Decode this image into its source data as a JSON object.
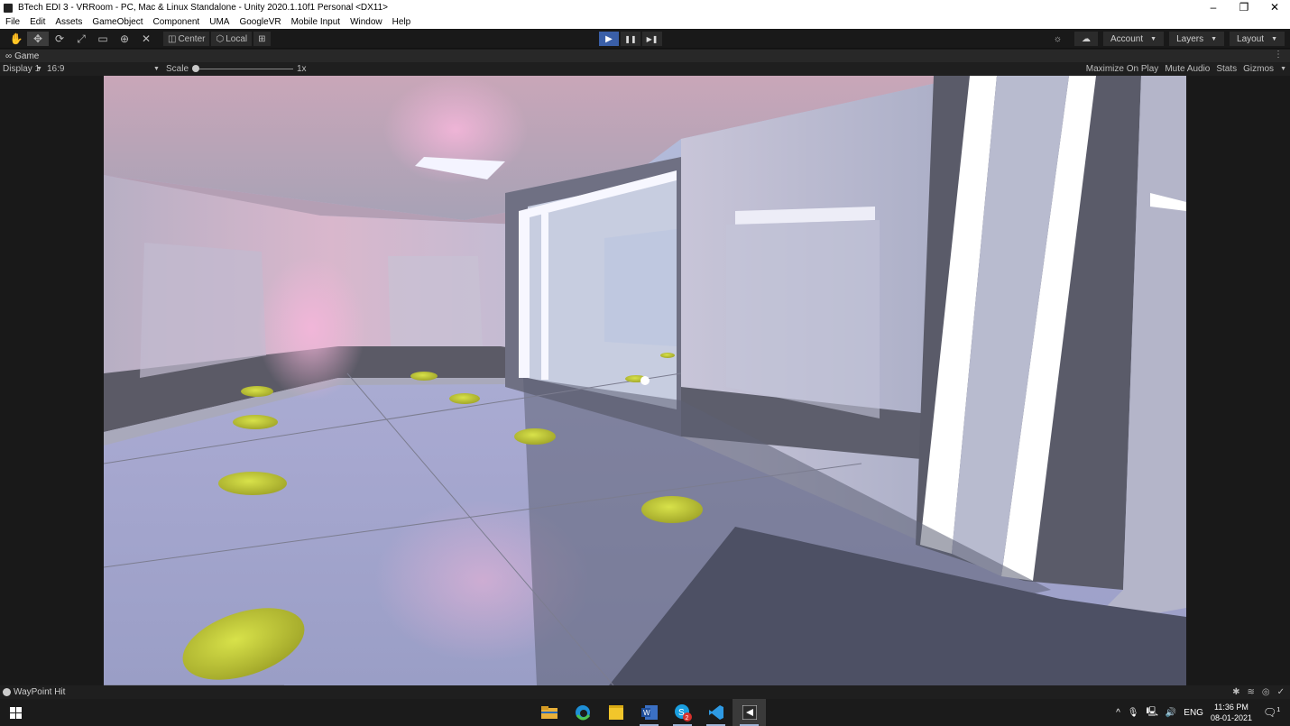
{
  "window": {
    "title": "BTech EDI 3 - VRRoom - PC, Mac & Linux Standalone - Unity 2020.1.10f1 Personal <DX11>",
    "minimize": "–",
    "restore": "❐",
    "close": "✕"
  },
  "menu": [
    "File",
    "Edit",
    "Assets",
    "GameObject",
    "Component",
    "UMA",
    "GoogleVR",
    "Mobile Input",
    "Window",
    "Help"
  ],
  "toolbar": {
    "tools": [
      "✋",
      "✥",
      "⟳",
      "⤢",
      "▭",
      "⊕",
      "✕"
    ],
    "pivot_center": "Center",
    "pivot_local": "Local",
    "play": "▶",
    "pause": "❚❚",
    "step": "▶❚",
    "collab": "☼",
    "cloud": "☁",
    "account": "Account",
    "layers": "Layers",
    "layout": "Layout"
  },
  "game_tab": {
    "label": "Game",
    "display": "Display 1",
    "aspect": "16:9",
    "scale_label": "Scale",
    "scale_value": "1x",
    "scale_fraction": 0.0,
    "maximize_on_play": "Maximize On Play",
    "mute_audio": "Mute Audio",
    "stats": "Stats",
    "gizmos": "Gizmos"
  },
  "status": {
    "message": "WayPoint Hit"
  },
  "taskbar": {
    "lang": "ENG",
    "time": "11:36 PM",
    "date": "08-01-2021",
    "skype_badge": "2",
    "notification_count": "1"
  }
}
